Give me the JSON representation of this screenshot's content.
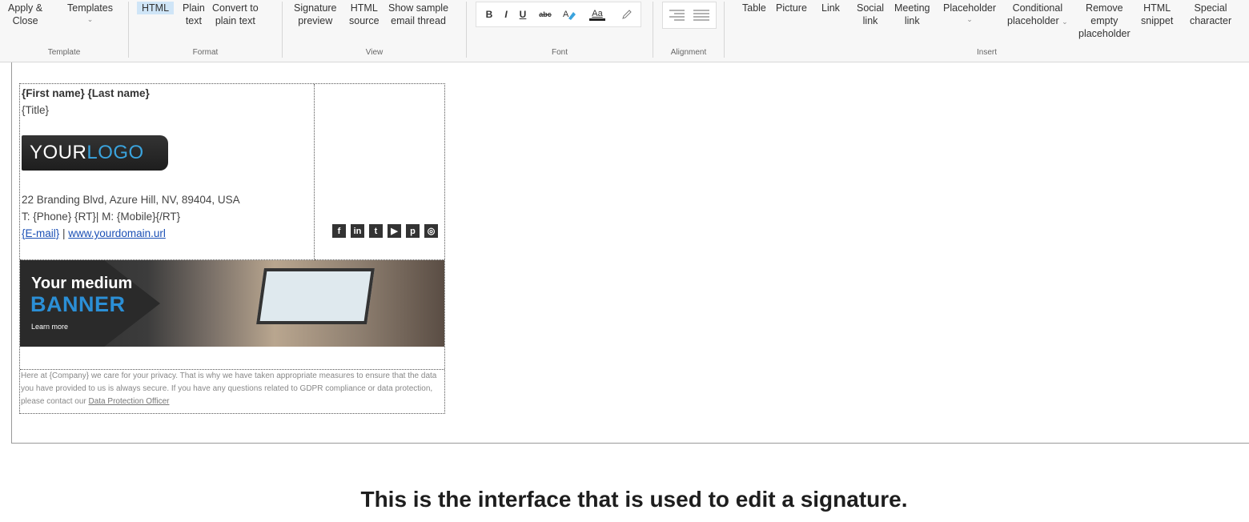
{
  "ribbon": {
    "template": {
      "apply": "Apply &",
      "close": "Close",
      "templates": "Templates",
      "label": "Template"
    },
    "format": {
      "html": "HTML",
      "plain1": "Plain",
      "plain2": "text",
      "convert1": "Convert to",
      "convert2": "plain text",
      "label": "Format"
    },
    "view": {
      "sig1": "Signature",
      "sig2": "preview",
      "src1": "HTML",
      "src2": "source",
      "thread1": "Show sample",
      "thread2": "email thread",
      "label": "View"
    },
    "font": {
      "bold": "B",
      "italic": "I",
      "underline": "U",
      "strike": "abc",
      "fontsize": "Aa",
      "label": "Font"
    },
    "alignment": {
      "label": "Alignment"
    },
    "insert": {
      "table": "Table",
      "picture": "Picture",
      "link": "Link",
      "social1": "Social",
      "social2": "link",
      "meeting1": "Meeting",
      "meeting2": "link",
      "placeholder": "Placeholder",
      "cond1": "Conditional",
      "cond2": "placeholder",
      "remove1": "Remove",
      "remove2": "empty",
      "remove3": "placeholder",
      "snip1": "HTML",
      "snip2": "snippet",
      "spec1": "Special",
      "spec2": "character",
      "label": "Insert"
    }
  },
  "signature": {
    "name": "{First name} {Last name}",
    "title": "{Title}",
    "logo_white": "YOUR",
    "logo_blue": "LOGO",
    "address": "22 Branding Blvd, Azure Hill, NV, 89404, USA",
    "phone": "T: {Phone} {RT}| M: {Mobile}{/RT}",
    "email": "{E-mail}",
    "sep": " | ",
    "website": "www.yourdomain.url",
    "social": [
      "f",
      "in",
      "t",
      "▶",
      "p",
      "◎"
    ],
    "banner_line1": "Your medium",
    "banner_line2": "BANNER",
    "banner_cta": "Learn more",
    "gdpr_text": "Here at {Company} we care for your privacy. That is why we have taken appropriate measures to ensure that the data you have provided to us is always secure. If you have any questions related to GDPR compliance or data protection, please contact our ",
    "gdpr_link": "Data Protection Officer"
  },
  "caption": "This is the interface that is used to edit a signature.",
  "colors": {
    "accent": "#2b8fd6",
    "selected": "#cfe5f7",
    "link": "#1a4fb5"
  }
}
